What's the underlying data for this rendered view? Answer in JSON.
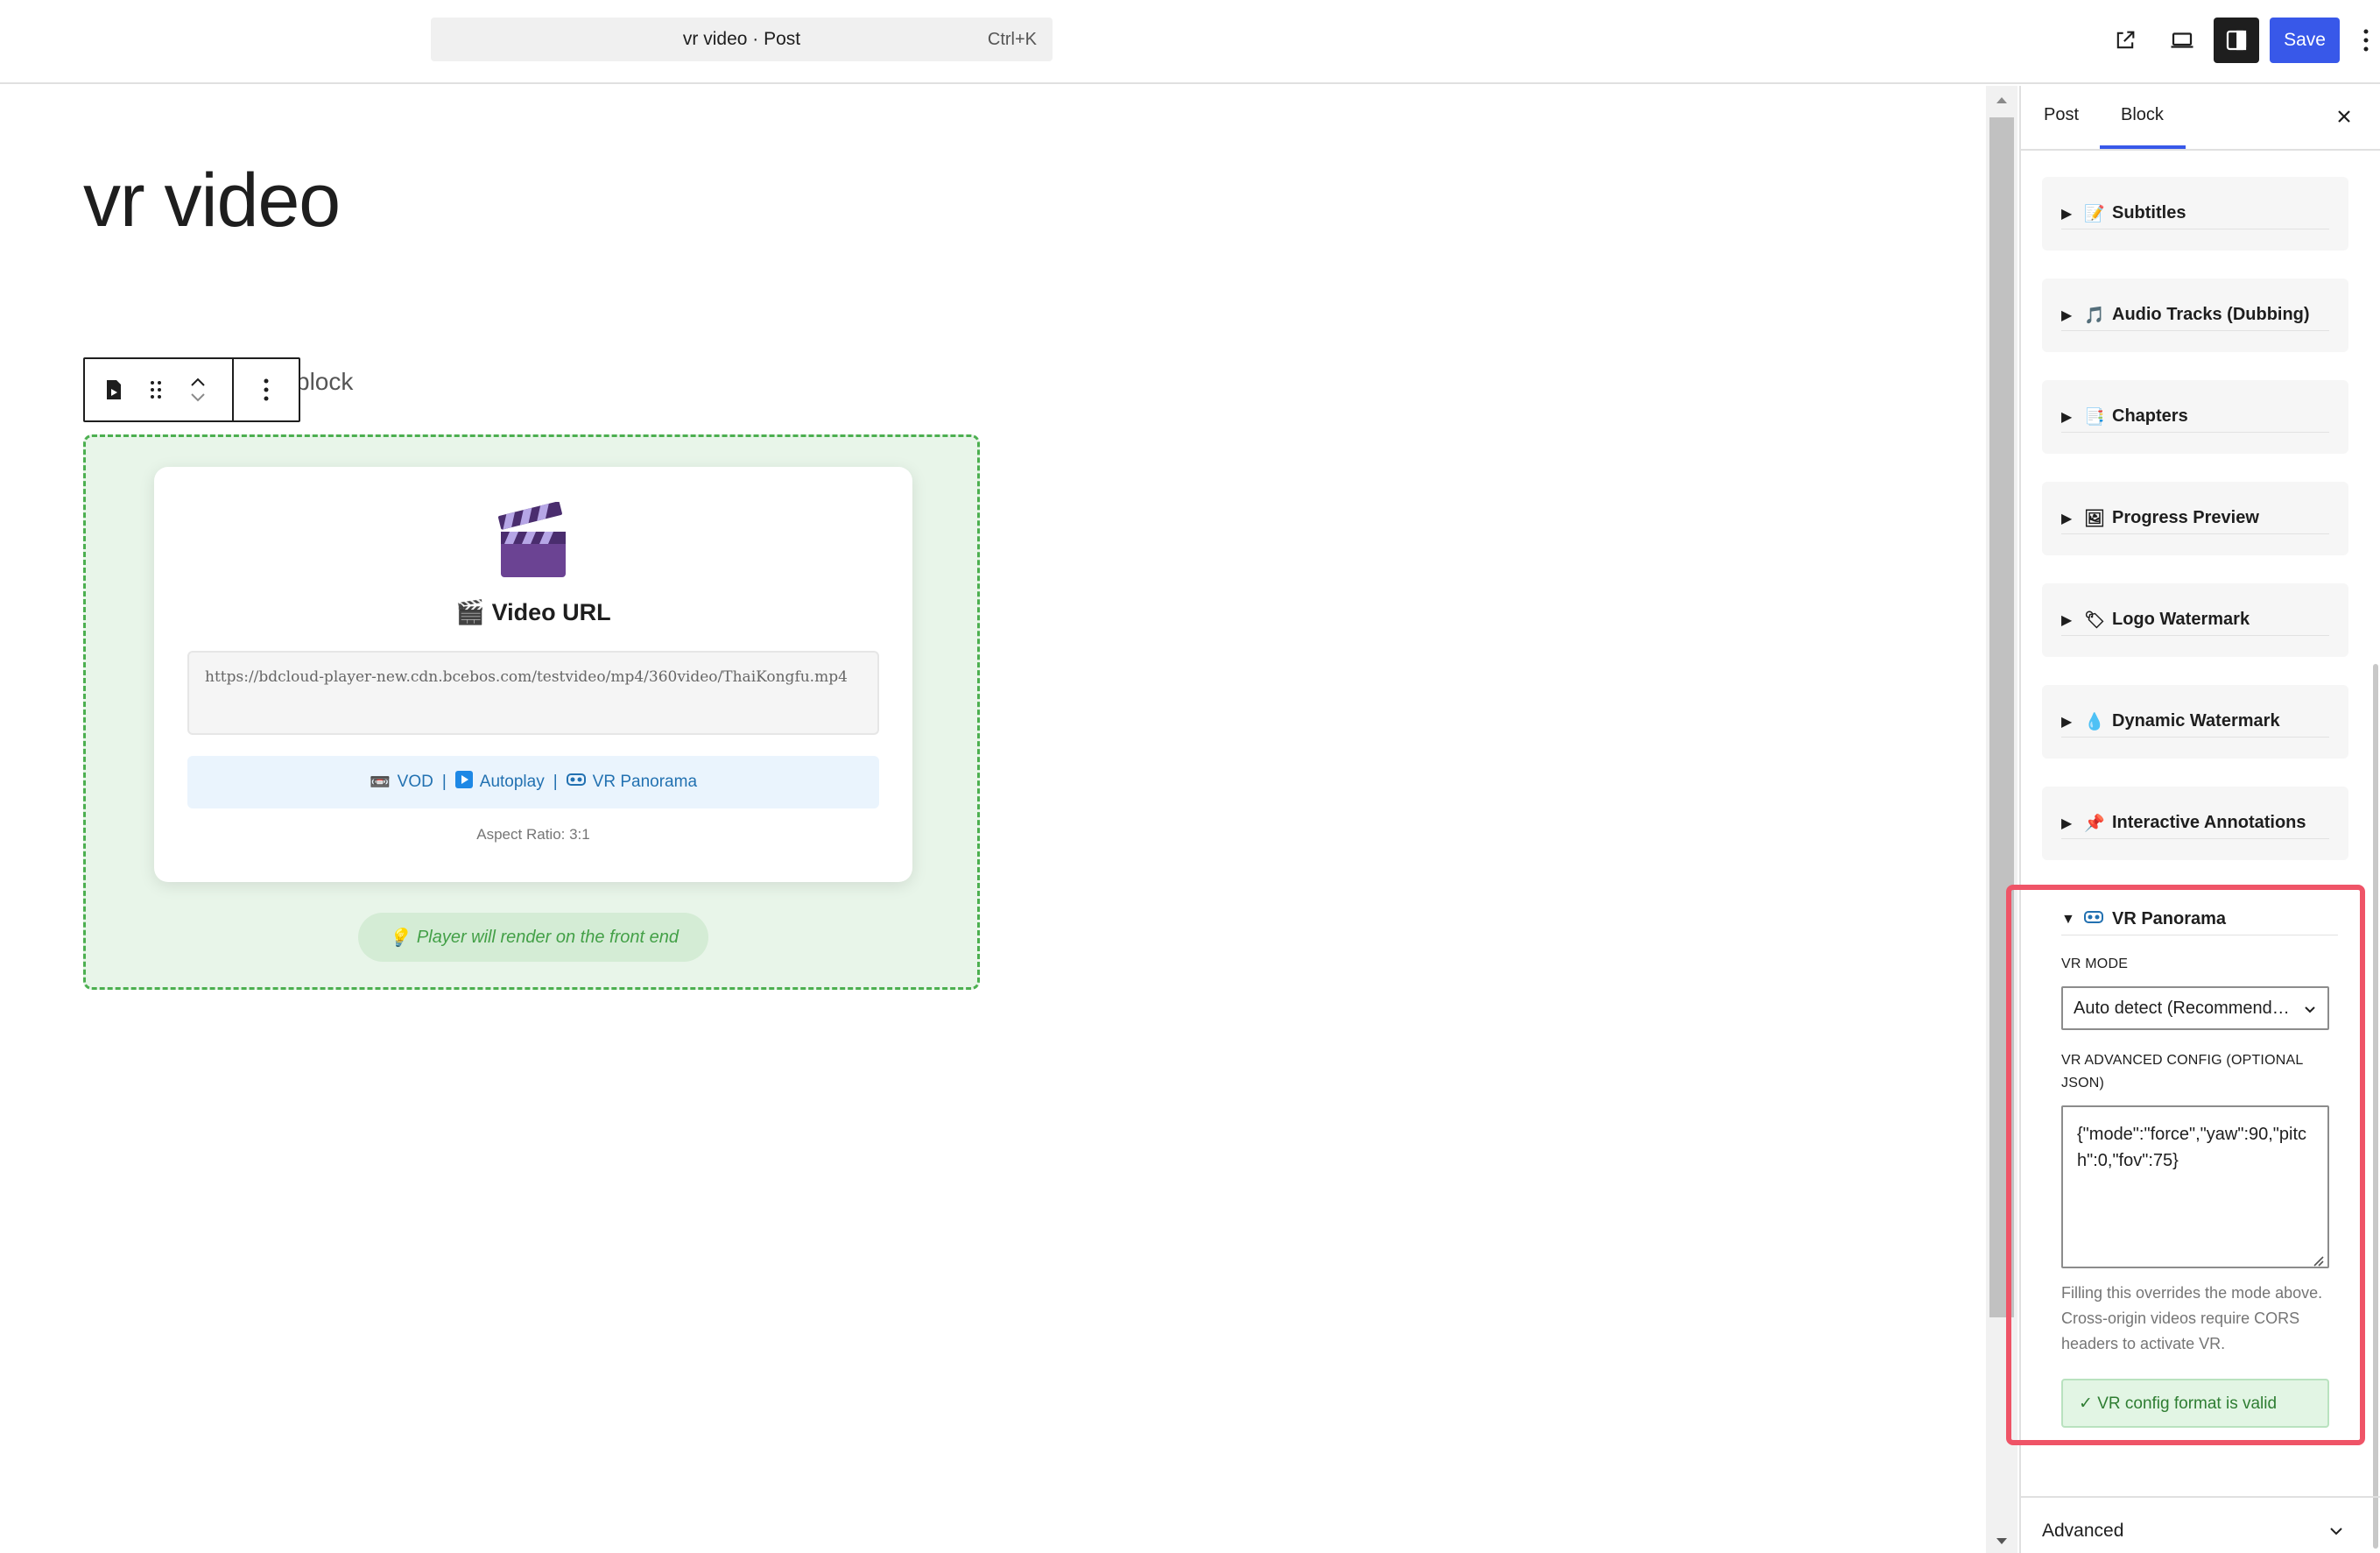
{
  "topbar": {
    "command_title": "vr video · Post",
    "command_shortcut": "Ctrl+K",
    "save_label": "Save",
    "icons": [
      "external-link-icon",
      "desktop-preview-icon",
      "sidebar-toggle-icon",
      "options-icon"
    ]
  },
  "editor": {
    "post_title": "vr video",
    "ghost_text": "block",
    "block_toolbar": {
      "icons": [
        "video-block-icon",
        "drag-handle-icon",
        "move-up-icon",
        "move-down-icon",
        "more-options-icon"
      ]
    },
    "video_block": {
      "card_title": "Video URL",
      "url": "https://bdcloud-player-new.cdn.bcebos.com/testvideo/mp4/360video/ThaiKongfu.mp4",
      "modes": {
        "vod": "VOD",
        "autoplay": "Autoplay",
        "vr": "VR Panorama",
        "separator": "|"
      },
      "aspect_ratio": "Aspect Ratio: 3:1",
      "render_note": "Player will render on the front end"
    }
  },
  "sidebar": {
    "tabs": [
      {
        "label": "Post"
      },
      {
        "label": "Block",
        "active": true
      }
    ],
    "panels": [
      {
        "label": "Subtitles",
        "emoji": "📝"
      },
      {
        "label": "Audio Tracks (Dubbing)",
        "emoji": "🎵"
      },
      {
        "label": "Chapters",
        "emoji": "📑"
      },
      {
        "label": "Progress Preview",
        "emoji": "🖼"
      },
      {
        "label": "Logo Watermark",
        "emoji": "🏷"
      },
      {
        "label": "Dynamic Watermark",
        "emoji": "💧"
      },
      {
        "label": "Interactive Annotations",
        "emoji": "📌"
      }
    ],
    "vr_panel": {
      "label": "VR Panorama",
      "emoji": "🥽",
      "mode_label": "VR Mode",
      "mode_value": "Auto detect (Recommended)",
      "config_label": "VR Advanced Config (Optional JSON)",
      "config_value": "{\"mode\":\"force\",\"yaw\":90,\"pitch\":0,\"fov\":75}",
      "help_text": "Filling this overrides the mode above. Cross-origin videos require CORS headers to activate VR.",
      "valid_message": "✓ VR config format is valid"
    },
    "advanced_label": "Advanced"
  },
  "colors": {
    "accent": "#3858e9",
    "highlight_frame": "#ef5467",
    "block_border": "#4caf50",
    "block_bg": "#e8f5e9",
    "link": "#2271b1"
  }
}
